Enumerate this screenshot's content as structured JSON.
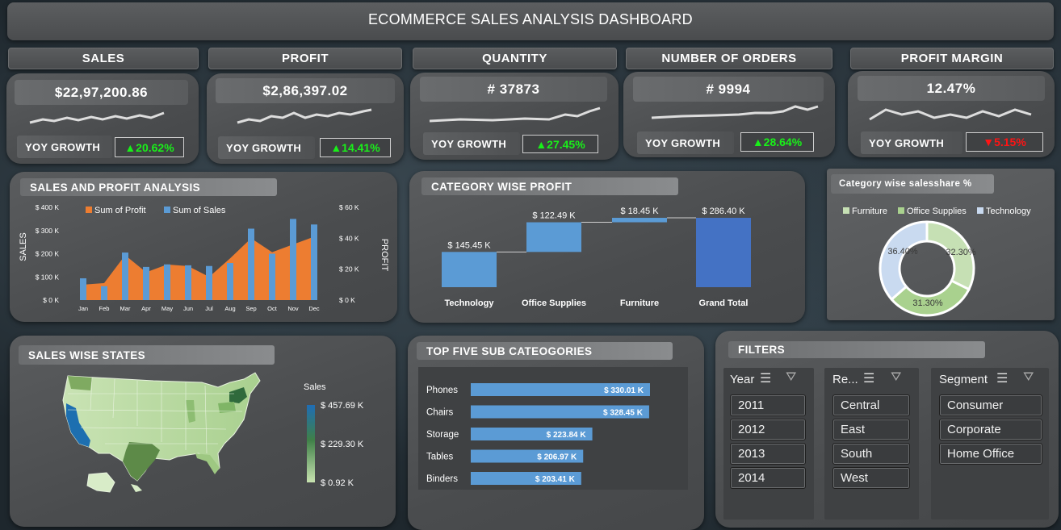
{
  "header": {
    "title": "ECOMMERCE SALES ANALYSIS DASHBOARD"
  },
  "kpis": [
    {
      "label": "SALES",
      "value": "$22,97,200.86",
      "yoy_label": "YOY GROWTH",
      "yoy": "▲20.62%",
      "yoy_dir": "up"
    },
    {
      "label": "PROFIT",
      "value": "$2,86,397.02",
      "yoy_label": "YOY GROWTH",
      "yoy": "▲14.41%",
      "yoy_dir": "up"
    },
    {
      "label": "QUANTITY",
      "value": "# 37873",
      "yoy_label": "YOY GROWTH",
      "yoy": "▲27.45%",
      "yoy_dir": "up"
    },
    {
      "label": "NUMBER OF ORDERS",
      "value": "# 9994",
      "yoy_label": "YOY GROWTH",
      "yoy": "▲28.64%",
      "yoy_dir": "up"
    },
    {
      "label": "PROFIT MARGIN",
      "value": "12.47%",
      "yoy_label": "YOY GROWTH",
      "yoy": "▼5.15%",
      "yoy_dir": "down"
    }
  ],
  "colors": {
    "up": "#19f019",
    "down": "#ff1414",
    "bar_blue": "#5b9bd5",
    "area_orange": "#ed7d31",
    "grand_total": "#4472c4"
  },
  "sales_profit": {
    "title": "SALES AND PROFIT ANALYSIS",
    "legend_profit": "Sum of Profit",
    "legend_sales": "Sum of Sales",
    "ylabel_left": "SALES",
    "ylabel_right": "PROFIT",
    "left_ticks": [
      "$ 400 K",
      "$ 300 K",
      "$ 200 K",
      "$ 100 K",
      "$ 0 K"
    ],
    "right_ticks": [
      "$ 60 K",
      "$ 40 K",
      "$ 20 K",
      "$ 0 K"
    ]
  },
  "category_profit": {
    "title": "CATEGORY WISE PROFIT",
    "bars": [
      {
        "label": "Technology",
        "value_label": "$ 145.45 K"
      },
      {
        "label": "Office Supplies",
        "value_label": "$ 122.49 K"
      },
      {
        "label": "Furniture",
        "value_label": "$ 18.45 K"
      },
      {
        "label": "Grand Total",
        "value_label": "$ 286.40 K"
      }
    ]
  },
  "salesshare": {
    "title": "Category wise salesshare %",
    "legend": [
      "Furniture",
      "Office Supplies",
      "Technology"
    ],
    "labels": [
      "32.30%",
      "31.30%",
      "36.40%"
    ]
  },
  "states": {
    "title": "SALES WISE STATES",
    "legend_title": "Sales",
    "legend_max": "$ 457.69 K",
    "legend_mid": "$ 229.30 K",
    "legend_min": "$ 0.92 K"
  },
  "subcats": {
    "title": "TOP FIVE SUB CATEOGORIES",
    "rows": [
      {
        "name": "Phones",
        "label": "$ 330.01 K"
      },
      {
        "name": "Chairs",
        "label": "$ 328.45 K"
      },
      {
        "name": "Storage",
        "label": "$ 223.84 K"
      },
      {
        "name": "Tables",
        "label": "$ 206.97 K"
      },
      {
        "name": "Binders",
        "label": "$ 203.41 K"
      }
    ]
  },
  "filters": {
    "title": "FILTERS",
    "year": {
      "head": "Year",
      "items": [
        "2011",
        "2012",
        "2013",
        "2014"
      ]
    },
    "region": {
      "head": "Re...",
      "items": [
        "Central",
        "East",
        "South",
        "West"
      ]
    },
    "segment": {
      "head": "Segment",
      "items": [
        "Consumer",
        "Corporate",
        "Home Office"
      ]
    }
  },
  "chart_data": [
    {
      "type": "bar",
      "title": "SALES AND PROFIT ANALYSIS",
      "categories": [
        "Jan",
        "Feb",
        "Mar",
        "Apr",
        "May",
        "Jun",
        "Jul",
        "Aug",
        "Sep",
        "Oct",
        "Nov",
        "Dec"
      ],
      "series": [
        {
          "name": "Sum of Sales",
          "values": [
            94,
            60,
            205,
            143,
            154,
            150,
            147,
            160,
            308,
            200,
            350,
            326
          ]
        },
        {
          "name": "Sum of Profit",
          "values": [
            10,
            11,
            29,
            18,
            23,
            22,
            15,
            27,
            40,
            31,
            36,
            41
          ]
        }
      ],
      "ylim_left": [
        0,
        400
      ],
      "ylim_right": [
        0,
        60
      ],
      "xlabel": "",
      "ylabel": "SALES"
    },
    {
      "type": "bar",
      "title": "CATEGORY WISE PROFIT",
      "categories": [
        "Technology",
        "Office Supplies",
        "Furniture",
        "Grand Total"
      ],
      "values": [
        145.45,
        122.49,
        18.45,
        286.4
      ]
    },
    {
      "type": "pie",
      "title": "Category wise salesshare %",
      "categories": [
        "Furniture",
        "Office Supplies",
        "Technology"
      ],
      "values": [
        32.3,
        31.3,
        36.4
      ]
    },
    {
      "type": "bar",
      "title": "TOP FIVE SUB CATEOGORIES",
      "categories": [
        "Phones",
        "Chairs",
        "Storage",
        "Tables",
        "Binders"
      ],
      "values": [
        330.01,
        328.45,
        223.84,
        206.97,
        203.41
      ]
    }
  ]
}
